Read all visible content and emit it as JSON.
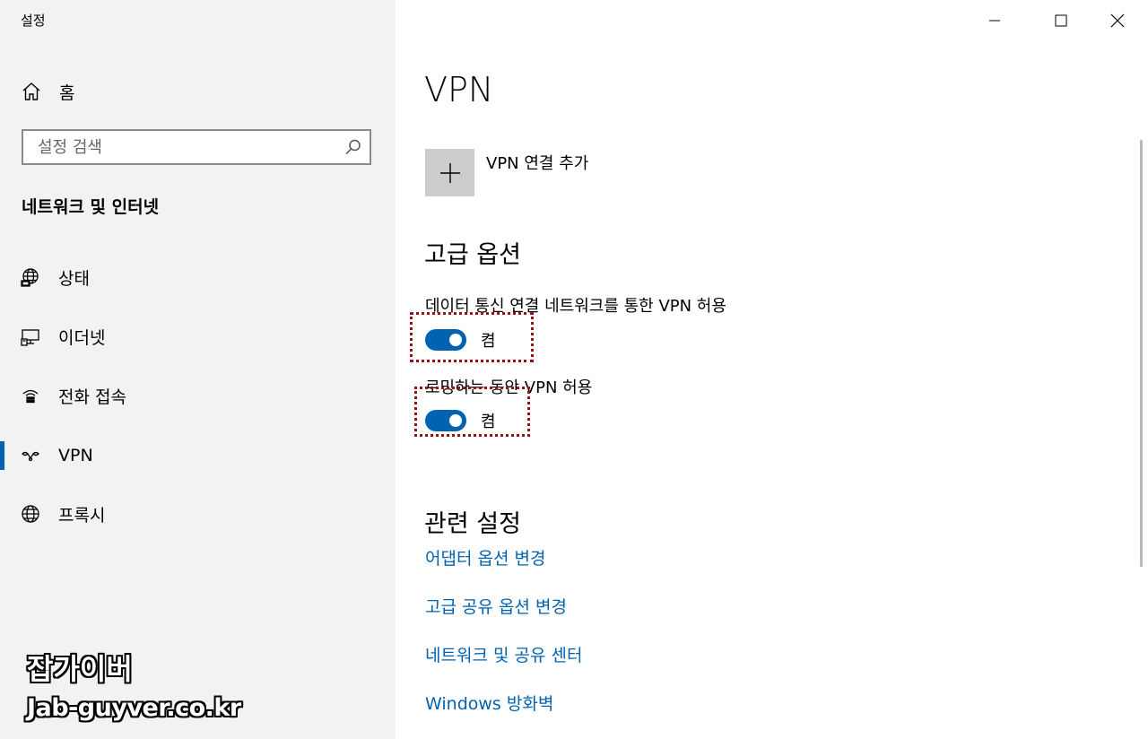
{
  "window": {
    "title": "설정"
  },
  "sidebar": {
    "home_label": "홈",
    "search_placeholder": "설정 검색",
    "section_title": "네트워크 및 인터넷",
    "items": [
      {
        "label": "상태",
        "icon": "globe-network-icon"
      },
      {
        "label": "이더넷",
        "icon": "ethernet-icon"
      },
      {
        "label": "전화 접속",
        "icon": "dialup-icon"
      },
      {
        "label": "VPN",
        "icon": "vpn-icon",
        "active": true
      },
      {
        "label": "프록시",
        "icon": "globe-icon"
      }
    ]
  },
  "main": {
    "title": "VPN",
    "add_vpn_label": "VPN 연결 추가",
    "advanced_title": "고급 옵션",
    "options": [
      {
        "label": "데이터 통신 연결 네트워크를 통한 VPN 허용",
        "state": "켬",
        "on": true
      },
      {
        "label": "로밍하는 동안 VPN 허용",
        "state": "켬",
        "on": true
      }
    ],
    "related_title": "관련 설정",
    "related_links": [
      "어댑터 옵션 변경",
      "고급 공유 옵션 변경",
      "네트워크 및 공유 센터",
      "Windows 방화벽"
    ]
  },
  "watermark": {
    "line1": "잡가이버",
    "line2": "Jab-guyver.co.kr"
  },
  "colors": {
    "accent": "#0063b1",
    "sidebar_bg": "#f2f2f2",
    "highlight": "#9b1111"
  }
}
